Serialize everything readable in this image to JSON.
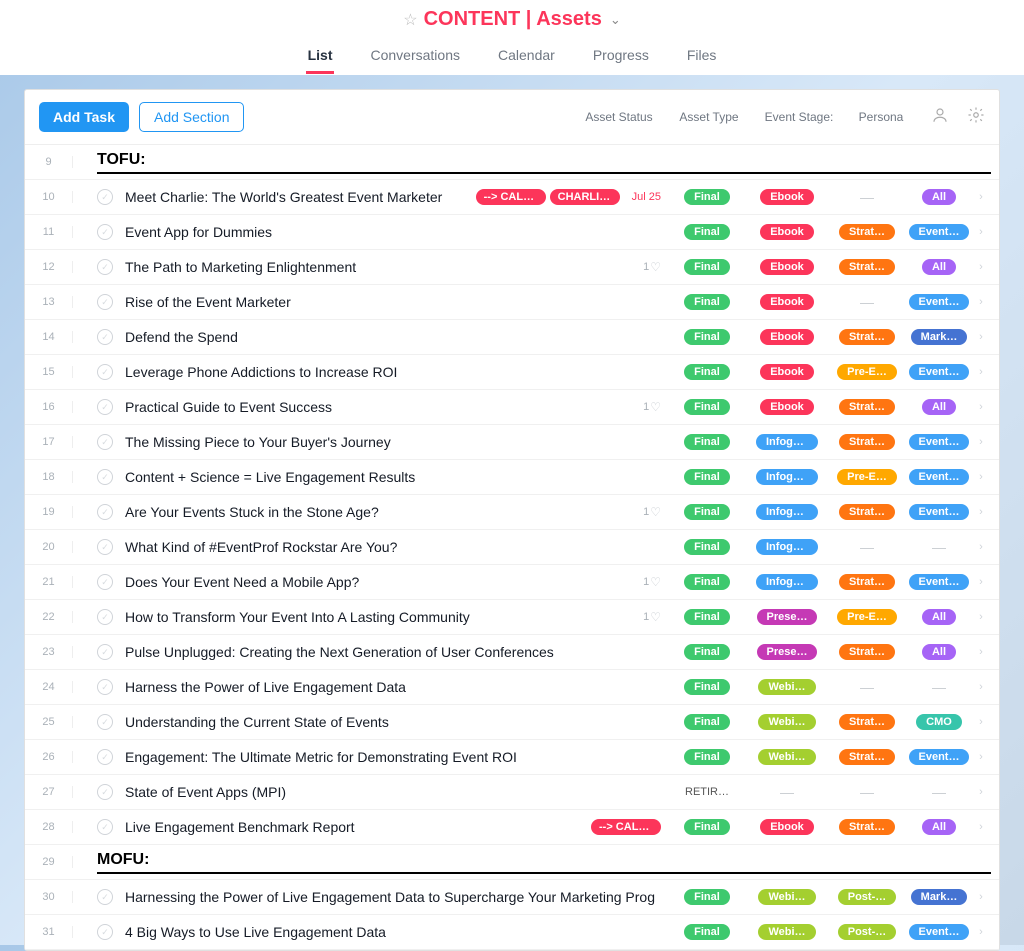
{
  "header": {
    "title": "CONTENT | Assets",
    "tabs": [
      "List",
      "Conversations",
      "Calendar",
      "Progress",
      "Files"
    ],
    "active_tab": 0
  },
  "toolbar": {
    "add_task_label": "Add Task",
    "add_section_label": "Add Section",
    "columns": {
      "status": "Asset Status",
      "type": "Asset Type",
      "stage": "Event Stage:",
      "persona": "Persona"
    }
  },
  "rows": [
    {
      "num": 9,
      "kind": "section",
      "label": "TOFU:"
    },
    {
      "num": 10,
      "kind": "task",
      "name": "Meet Charlie: The World's Greatest Event Marketer",
      "tags": [
        {
          "text": "--> CALE…",
          "color": "tag-red"
        },
        {
          "text": "CHARLIE …",
          "color": "tag-red"
        }
      ],
      "due": "Jul 25",
      "likes": null,
      "status": {
        "text": "Final",
        "color": "pill-green"
      },
      "type": {
        "text": "Ebook",
        "color": "pill-red"
      },
      "stage": null,
      "persona": {
        "text": "All",
        "color": "pill-purple"
      }
    },
    {
      "num": 11,
      "kind": "task",
      "name": "Event App for Dummies",
      "tags": [],
      "due": null,
      "likes": null,
      "status": {
        "text": "Final",
        "color": "pill-green"
      },
      "type": {
        "text": "Ebook",
        "color": "pill-red"
      },
      "stage": {
        "text": "Strat…",
        "color": "pill-orange"
      },
      "persona": {
        "text": "Event…",
        "color": "pill-blue"
      }
    },
    {
      "num": 12,
      "kind": "task",
      "name": "The Path to Marketing Enlightenment",
      "tags": [],
      "due": null,
      "likes": 1,
      "status": {
        "text": "Final",
        "color": "pill-green"
      },
      "type": {
        "text": "Ebook",
        "color": "pill-red"
      },
      "stage": {
        "text": "Strat…",
        "color": "pill-orange"
      },
      "persona": {
        "text": "All",
        "color": "pill-purple"
      }
    },
    {
      "num": 13,
      "kind": "task",
      "name": "Rise of the Event Marketer",
      "tags": [],
      "due": null,
      "likes": null,
      "status": {
        "text": "Final",
        "color": "pill-green"
      },
      "type": {
        "text": "Ebook",
        "color": "pill-red"
      },
      "stage": null,
      "persona": {
        "text": "Event…",
        "color": "pill-blue"
      }
    },
    {
      "num": 14,
      "kind": "task",
      "name": "Defend the Spend",
      "tags": [],
      "due": null,
      "likes": null,
      "status": {
        "text": "Final",
        "color": "pill-green"
      },
      "type": {
        "text": "Ebook",
        "color": "pill-red"
      },
      "stage": {
        "text": "Strat…",
        "color": "pill-orange"
      },
      "persona": {
        "text": "Mark…",
        "color": "pill-bluedk"
      }
    },
    {
      "num": 15,
      "kind": "task",
      "name": "Leverage Phone Addictions to Increase ROI",
      "tags": [],
      "due": null,
      "likes": null,
      "status": {
        "text": "Final",
        "color": "pill-green"
      },
      "type": {
        "text": "Ebook",
        "color": "pill-red"
      },
      "stage": {
        "text": "Pre-E…",
        "color": "pill-yelloworange"
      },
      "persona": {
        "text": "Event…",
        "color": "pill-blue"
      }
    },
    {
      "num": 16,
      "kind": "task",
      "name": "Practical Guide to Event Success",
      "tags": [],
      "due": null,
      "likes": 1,
      "status": {
        "text": "Final",
        "color": "pill-green"
      },
      "type": {
        "text": "Ebook",
        "color": "pill-red"
      },
      "stage": {
        "text": "Strat…",
        "color": "pill-orange"
      },
      "persona": {
        "text": "All",
        "color": "pill-purple"
      }
    },
    {
      "num": 17,
      "kind": "task",
      "name": "The Missing Piece to Your Buyer's Journey",
      "tags": [],
      "due": null,
      "likes": null,
      "status": {
        "text": "Final",
        "color": "pill-green"
      },
      "type": {
        "text": "Infogr…",
        "color": "pill-blue"
      },
      "stage": {
        "text": "Strat…",
        "color": "pill-orange"
      },
      "persona": {
        "text": "Event…",
        "color": "pill-blue"
      }
    },
    {
      "num": 18,
      "kind": "task",
      "name": "Content + Science = Live Engagement Results",
      "tags": [],
      "due": null,
      "likes": null,
      "status": {
        "text": "Final",
        "color": "pill-green"
      },
      "type": {
        "text": "Infogr…",
        "color": "pill-blue"
      },
      "stage": {
        "text": "Pre-E…",
        "color": "pill-yelloworange"
      },
      "persona": {
        "text": "Event…",
        "color": "pill-blue"
      }
    },
    {
      "num": 19,
      "kind": "task",
      "name": "Are Your Events Stuck in the Stone Age?",
      "tags": [],
      "due": null,
      "likes": 1,
      "status": {
        "text": "Final",
        "color": "pill-green"
      },
      "type": {
        "text": "Infogr…",
        "color": "pill-blue"
      },
      "stage": {
        "text": "Strat…",
        "color": "pill-orange"
      },
      "persona": {
        "text": "Event…",
        "color": "pill-blue"
      }
    },
    {
      "num": 20,
      "kind": "task",
      "name": "What Kind of #EventProf Rockstar Are You?",
      "tags": [],
      "due": null,
      "likes": null,
      "status": {
        "text": "Final",
        "color": "pill-green"
      },
      "type": {
        "text": "Infogr…",
        "color": "pill-blue"
      },
      "stage": null,
      "persona": null
    },
    {
      "num": 21,
      "kind": "task",
      "name": "Does Your Event Need a Mobile App?",
      "tags": [],
      "due": null,
      "likes": 1,
      "status": {
        "text": "Final",
        "color": "pill-green"
      },
      "type": {
        "text": "Infogr…",
        "color": "pill-blue"
      },
      "stage": {
        "text": "Strat…",
        "color": "pill-orange"
      },
      "persona": {
        "text": "Event…",
        "color": "pill-blue"
      }
    },
    {
      "num": 22,
      "kind": "task",
      "name": "How to Transform Your Event Into A Lasting Community",
      "tags": [],
      "due": null,
      "likes": 1,
      "status": {
        "text": "Final",
        "color": "pill-green"
      },
      "type": {
        "text": "Prese…",
        "color": "pill-magenta"
      },
      "stage": {
        "text": "Pre-E…",
        "color": "pill-yelloworange"
      },
      "persona": {
        "text": "All",
        "color": "pill-purple"
      }
    },
    {
      "num": 23,
      "kind": "task",
      "name": "Pulse Unplugged: Creating the Next Generation of User Conferences",
      "tags": [],
      "due": null,
      "likes": null,
      "status": {
        "text": "Final",
        "color": "pill-green"
      },
      "type": {
        "text": "Prese…",
        "color": "pill-magenta"
      },
      "stage": {
        "text": "Strat…",
        "color": "pill-orange"
      },
      "persona": {
        "text": "All",
        "color": "pill-purple"
      }
    },
    {
      "num": 24,
      "kind": "task",
      "name": "Harness the Power of Live Engagement Data",
      "tags": [],
      "due": null,
      "likes": null,
      "status": {
        "text": "Final",
        "color": "pill-green"
      },
      "type": {
        "text": "Webi…",
        "color": "pill-lime"
      },
      "stage": null,
      "persona": null
    },
    {
      "num": 25,
      "kind": "task",
      "name": "Understanding the Current State of Events",
      "tags": [],
      "due": null,
      "likes": null,
      "status": {
        "text": "Final",
        "color": "pill-green"
      },
      "type": {
        "text": "Webi…",
        "color": "pill-lime"
      },
      "stage": {
        "text": "Strat…",
        "color": "pill-orange"
      },
      "persona": {
        "text": "CMO",
        "color": "pill-teal"
      }
    },
    {
      "num": 26,
      "kind": "task",
      "name": "Engagement: The Ultimate Metric for Demonstrating Event ROI",
      "tags": [],
      "due": null,
      "likes": null,
      "status": {
        "text": "Final",
        "color": "pill-green"
      },
      "type": {
        "text": "Webi…",
        "color": "pill-lime"
      },
      "stage": {
        "text": "Strat…",
        "color": "pill-orange"
      },
      "persona": {
        "text": "Event…",
        "color": "pill-blue"
      }
    },
    {
      "num": 27,
      "kind": "task",
      "name": "State of Event Apps (MPI)",
      "tags": [],
      "due": null,
      "likes": null,
      "status_text": "RETIR…",
      "type": null,
      "stage": null,
      "persona": null
    },
    {
      "num": 28,
      "kind": "task",
      "name": "Live Engagement Benchmark Report",
      "tags": [
        {
          "text": "--> CALE…",
          "color": "tag-red"
        }
      ],
      "due": null,
      "likes": null,
      "status": {
        "text": "Final",
        "color": "pill-green"
      },
      "type": {
        "text": "Ebook",
        "color": "pill-red"
      },
      "stage": {
        "text": "Strat…",
        "color": "pill-orange"
      },
      "persona": {
        "text": "All",
        "color": "pill-purple"
      }
    },
    {
      "num": 29,
      "kind": "section",
      "label": "MOFU:"
    },
    {
      "num": 30,
      "kind": "task",
      "name": "Harnessing the Power of Live Engagement Data to Supercharge Your Marketing Prog",
      "tags": [],
      "due": null,
      "likes": null,
      "status": {
        "text": "Final",
        "color": "pill-green"
      },
      "type": {
        "text": "Webi…",
        "color": "pill-lime"
      },
      "stage": {
        "text": "Post-…",
        "color": "pill-lime"
      },
      "persona": {
        "text": "Mark…",
        "color": "pill-bluedk"
      }
    },
    {
      "num": 31,
      "kind": "task",
      "name": "4 Big Ways to Use Live Engagement Data",
      "tags": [],
      "due": null,
      "likes": null,
      "status": {
        "text": "Final",
        "color": "pill-green"
      },
      "type": {
        "text": "Webi…",
        "color": "pill-lime"
      },
      "stage": {
        "text": "Post-…",
        "color": "pill-lime"
      },
      "persona": {
        "text": "Event…",
        "color": "pill-blue"
      }
    }
  ]
}
